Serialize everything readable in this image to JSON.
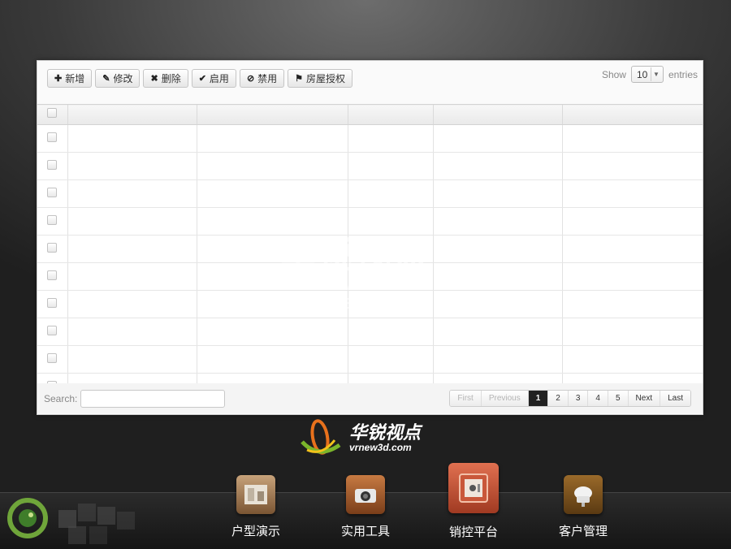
{
  "toolbar": {
    "add": "新增",
    "edit": "修改",
    "delete": "删除",
    "enable": "启用",
    "disable": "禁用",
    "house_auth": "房屋授权"
  },
  "show_entries": {
    "prefix": "Show",
    "value": "10",
    "suffix": "entries"
  },
  "search": {
    "label": "Search:",
    "value": ""
  },
  "pagination": [
    "First",
    "Previous",
    "1",
    "2",
    "3",
    "4",
    "5",
    "Next",
    "Last"
  ],
  "pagination_current": "1",
  "watermark": {
    "line1": "华锐视点",
    "line2": "www.vrnew3d.com",
    "line3": "QQ:  652080911"
  },
  "logo": {
    "brand": "华锐视点",
    "url": "vrnew3d.com"
  },
  "nav": [
    {
      "label": "户型演示",
      "icon": "room-layout-icon"
    },
    {
      "label": "实用工具",
      "icon": "camera-tools-icon"
    },
    {
      "label": "销控平台",
      "icon": "safe-icon"
    },
    {
      "label": "客户管理",
      "icon": "armchair-icon"
    }
  ],
  "colors": {
    "accent_current_page": "#222222",
    "logo_orange": "#e8711c",
    "logo_green": "#7bb52b"
  }
}
